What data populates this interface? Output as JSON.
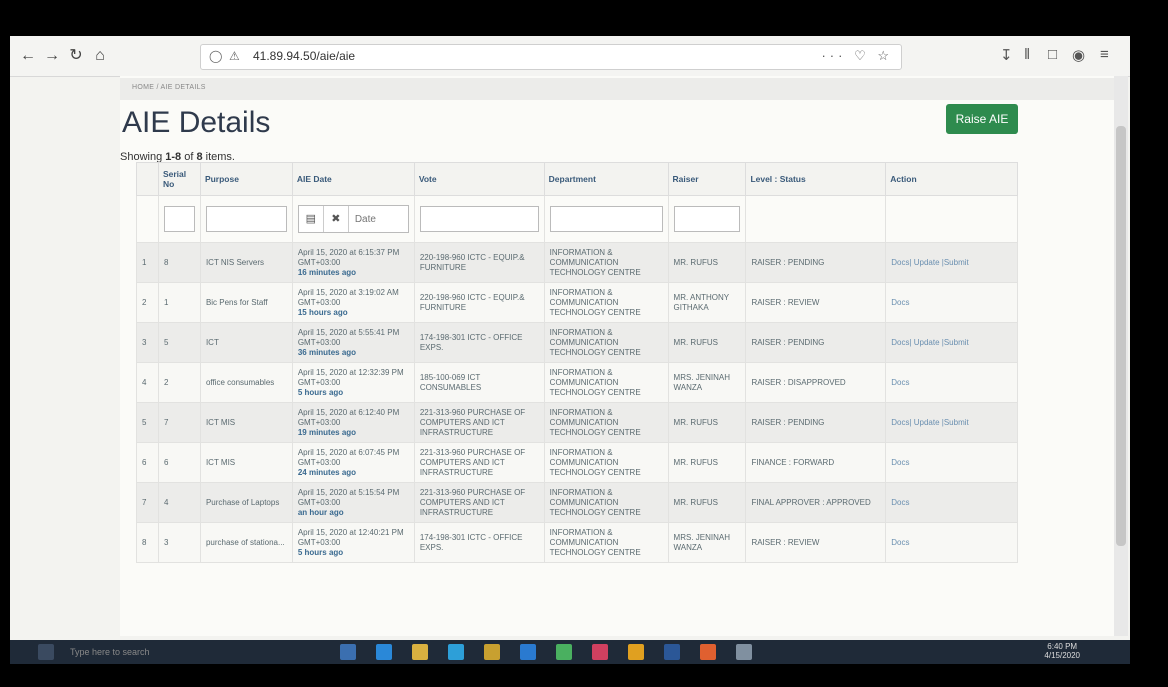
{
  "browser": {
    "url": "41.89.94.50/aie/aie",
    "url_right_icons": "··· ♡ ☆"
  },
  "breadcrumb": "HOME / AIE DETAILS",
  "page_title": "AIE Details",
  "raise_button": "Raise AIE",
  "summary": {
    "prefix": "Showing ",
    "range": "1-8",
    "middle": " of ",
    "total": "8",
    "suffix": " items."
  },
  "columns": [
    "",
    "Serial No",
    "Purpose",
    "AIE Date",
    "Vote",
    "Department",
    "Raiser",
    "Level : Status",
    "Action"
  ],
  "date_filter_placeholder": "Date",
  "rows": [
    {
      "idx": "1",
      "serial": "8",
      "purpose": "ICT NIS Servers",
      "date": "April 15, 2020 at 6:15:37 PM GMT+03:00",
      "ago": "16 minutes ago",
      "vote": "220-198-960 ICTC - EQUIP.& FURNITURE",
      "dept": "INFORMATION & COMMUNICATION TECHNOLOGY CENTRE",
      "raiser": "MR. RUFUS",
      "status": "RAISER : PENDING",
      "action": "Docs| Update |Submit"
    },
    {
      "idx": "2",
      "serial": "1",
      "purpose": "Bic Pens for Staff",
      "date": "April 15, 2020 at 3:19:02 AM GMT+03:00",
      "ago": "15 hours ago",
      "vote": "220-198-960 ICTC - EQUIP.& FURNITURE",
      "dept": "INFORMATION & COMMUNICATION TECHNOLOGY CENTRE",
      "raiser": "MR. ANTHONY GITHAKA",
      "status": "RAISER : REVIEW",
      "action": "Docs"
    },
    {
      "idx": "3",
      "serial": "5",
      "purpose": "ICT",
      "date": "April 15, 2020 at 5:55:41 PM GMT+03:00",
      "ago": "36 minutes ago",
      "vote": "174-198-301 ICTC - OFFICE EXPS.",
      "dept": "INFORMATION & COMMUNICATION TECHNOLOGY CENTRE",
      "raiser": "MR. RUFUS",
      "status": "RAISER : PENDING",
      "action": "Docs| Update |Submit"
    },
    {
      "idx": "4",
      "serial": "2",
      "purpose": "office consumables",
      "date": "April 15, 2020 at 12:32:39 PM GMT+03:00",
      "ago": "5 hours ago",
      "vote": "185-100-069 ICT CONSUMABLES",
      "dept": "INFORMATION & COMMUNICATION TECHNOLOGY CENTRE",
      "raiser": "MRS. JENINAH WANZA",
      "status": "RAISER : DISAPPROVED",
      "action": "Docs"
    },
    {
      "idx": "5",
      "serial": "7",
      "purpose": "ICT MIS",
      "date": "April 15, 2020 at 6:12:40 PM GMT+03:00",
      "ago": "19 minutes ago",
      "vote": "221-313-960 PURCHASE OF COMPUTERS AND ICT INFRASTRUCTURE",
      "dept": "INFORMATION & COMMUNICATION TECHNOLOGY CENTRE",
      "raiser": "MR. RUFUS",
      "status": "RAISER : PENDING",
      "action": "Docs| Update |Submit"
    },
    {
      "idx": "6",
      "serial": "6",
      "purpose": "ICT MIS",
      "date": "April 15, 2020 at 6:07:45 PM GMT+03:00",
      "ago": "24 minutes ago",
      "vote": "221-313-960 PURCHASE OF COMPUTERS AND ICT INFRASTRUCTURE",
      "dept": "INFORMATION & COMMUNICATION TECHNOLOGY CENTRE",
      "raiser": "MR. RUFUS",
      "status": "FINANCE : FORWARD",
      "action": "Docs"
    },
    {
      "idx": "7",
      "serial": "4",
      "purpose": "Purchase of Laptops",
      "date": "April 15, 2020 at 5:15:54 PM GMT+03:00",
      "ago": "an hour ago",
      "vote": "221-313-960 PURCHASE OF COMPUTERS AND ICT INFRASTRUCTURE",
      "dept": "INFORMATION & COMMUNICATION TECHNOLOGY CENTRE",
      "raiser": "MR. RUFUS",
      "status": "FINAL APPROVER : APPROVED",
      "action": "Docs"
    },
    {
      "idx": "8",
      "serial": "3",
      "purpose": "purchase of stationa...",
      "date": "April 15, 2020 at 12:40:21 PM GMT+03:00",
      "ago": "5 hours ago",
      "vote": "174-198-301 ICTC - OFFICE EXPS.",
      "dept": "INFORMATION & COMMUNICATION TECHNOLOGY CENTRE",
      "raiser": "MRS. JENINAH WANZA",
      "status": "RAISER : REVIEW",
      "action": "Docs"
    }
  ],
  "taskbar": {
    "search_placeholder": "Type here to search",
    "time": "6:40 PM",
    "date": "4/15/2020"
  },
  "colors": {
    "accent": "#2e8b4e",
    "taskbar": "#1f2a38"
  }
}
